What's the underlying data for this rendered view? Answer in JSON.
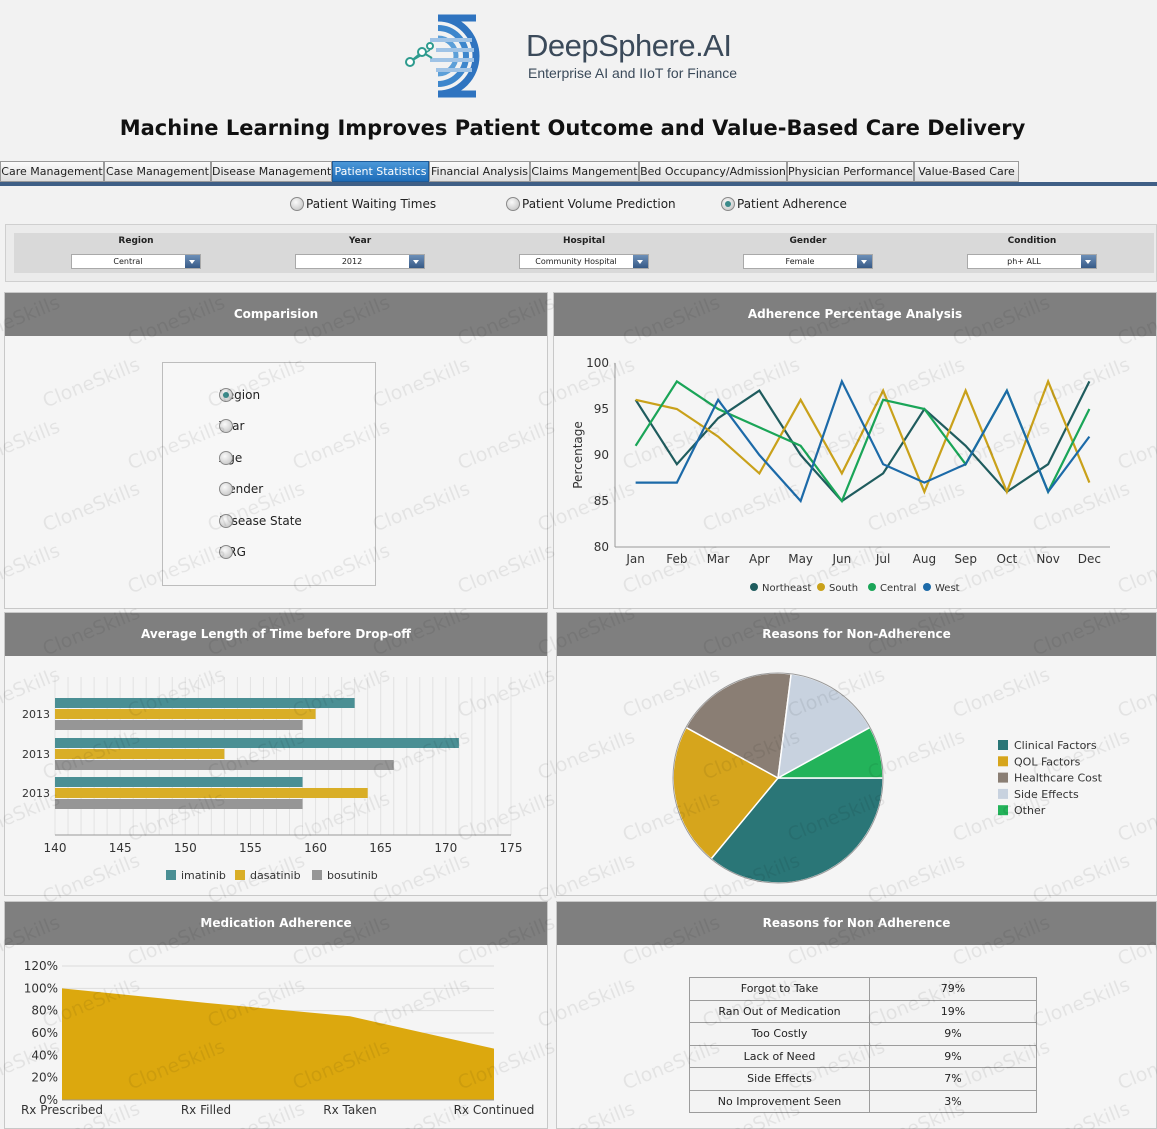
{
  "brand": {
    "name": "DeepSphere.AI",
    "tagline": "Enterprise AI and IIoT for Finance"
  },
  "page_title": "Machine Learning Improves Patient Outcome and Value-Based Care Delivery",
  "tabs": [
    {
      "label": "Care Management",
      "active": false
    },
    {
      "label": "Case Management",
      "active": false
    },
    {
      "label": "Disease Management",
      "active": false
    },
    {
      "label": "Patient Statistics",
      "active": true
    },
    {
      "label": "Financial Analysis",
      "active": false
    },
    {
      "label": "Claims Mangement",
      "active": false
    },
    {
      "label": "Bed Occupancy/Admission",
      "active": false
    },
    {
      "label": "Physician Performance",
      "active": false
    },
    {
      "label": "Value-Based Care",
      "active": false
    }
  ],
  "view_options": [
    {
      "label": "Patient Waiting Times",
      "selected": false
    },
    {
      "label": "Patient Volume Prediction",
      "selected": false
    },
    {
      "label": "Patient Adherence",
      "selected": true
    }
  ],
  "filters": [
    {
      "label": "Region",
      "value": "Central"
    },
    {
      "label": "Year",
      "value": "2012"
    },
    {
      "label": "Hospital",
      "value": "Community Hospital"
    },
    {
      "label": "Gender",
      "value": "Female"
    },
    {
      "label": "Condition",
      "value": "ph+ ALL"
    }
  ],
  "comparison": {
    "title": "Comparision",
    "options": [
      {
        "label": "Region",
        "selected": true
      },
      {
        "label": "Year",
        "selected": false
      },
      {
        "label": "Age",
        "selected": false
      },
      {
        "label": "Gender",
        "selected": false
      },
      {
        "label": "Disease State",
        "selected": false
      },
      {
        "label": "DRG",
        "selected": false
      }
    ]
  },
  "watermark": "CloneSkills",
  "colors": {
    "accent_tab": "#2a79c4",
    "panel_header": "#7f7f7f"
  },
  "chart_data": [
    {
      "type": "line",
      "title": "Adherence Percentage Analysis",
      "ylabel": "Percentage",
      "x": [
        "Jan",
        "Feb",
        "Mar",
        "Apr",
        "May",
        "Jun",
        "Jul",
        "Aug",
        "Sep",
        "Oct",
        "Nov",
        "Dec"
      ],
      "ylim": [
        80,
        100
      ],
      "yticks": [
        80,
        85,
        90,
        95,
        100
      ],
      "grid": false,
      "legend": "bottom",
      "series": [
        {
          "name": "Northeast",
          "color": "#1f5c5e",
          "values": [
            96,
            89,
            94,
            97,
            90,
            85,
            88,
            95,
            91,
            86,
            89,
            98
          ]
        },
        {
          "name": "South",
          "color": "#c9a11a",
          "values": [
            96,
            95,
            92,
            88,
            96,
            88,
            97,
            86,
            97,
            86,
            98,
            87
          ]
        },
        {
          "name": "Central",
          "color": "#1aa558",
          "values": [
            91,
            98,
            95,
            93,
            91,
            85,
            96,
            95,
            89,
            97,
            86,
            95
          ]
        },
        {
          "name": "West",
          "color": "#1c6aa8",
          "values": [
            87,
            87,
            96,
            90,
            85,
            98,
            89,
            87,
            89,
            97,
            86,
            92
          ]
        }
      ]
    },
    {
      "type": "bar",
      "orientation": "horizontal",
      "title": "Average Length of Time before Drop-off",
      "categories": [
        "2013",
        "2013",
        "2013"
      ],
      "xlim": [
        140,
        175
      ],
      "xticks": [
        140,
        145,
        150,
        155,
        160,
        165,
        170,
        175
      ],
      "grid": true,
      "legend": "bottom",
      "series": [
        {
          "name": "imatinib",
          "color": "#4a8f94",
          "values": [
            163,
            171,
            159
          ]
        },
        {
          "name": "dasatinib",
          "color": "#d9ae27",
          "values": [
            160,
            153,
            164
          ]
        },
        {
          "name": "bosutinib",
          "color": "#969696",
          "values": [
            159,
            166,
            159
          ]
        }
      ]
    },
    {
      "type": "pie",
      "title": "Reasons for Non-Adherence",
      "legend": "right",
      "slices": [
        {
          "label": "Clinical Factors",
          "value": 36,
          "color": "#2a7677"
        },
        {
          "label": "QOL Factors",
          "value": 22,
          "color": "#d6a51c"
        },
        {
          "label": "Healthcare Cost",
          "value": 19,
          "color": "#8a7e74"
        },
        {
          "label": "Side Effects",
          "value": 15,
          "color": "#c8d2df"
        },
        {
          "label": "Other",
          "value": 8,
          "color": "#23b35a"
        }
      ]
    },
    {
      "type": "area",
      "title": "Medication Adherence",
      "categories": [
        "Rx Prescribed",
        "Rx Filled",
        "Rx Taken",
        "Rx Continued"
      ],
      "yticks": [
        "0%",
        "20%",
        "40%",
        "60%",
        "80%",
        "100%",
        "120%"
      ],
      "ylim": [
        0,
        120
      ],
      "grid": true,
      "series": [
        {
          "name": "",
          "color": "#dca80e",
          "values": [
            100,
            87,
            75,
            46
          ]
        }
      ]
    },
    {
      "type": "table",
      "title": "Reasons for Non Adherence",
      "rows": [
        {
          "reason": "Forgot to Take",
          "value": "79%"
        },
        {
          "reason": "Ran Out of Medication",
          "value": "19%"
        },
        {
          "reason": "Too Costly",
          "value": "9%"
        },
        {
          "reason": "Lack of Need",
          "value": "9%"
        },
        {
          "reason": "Side Effects",
          "value": "7%"
        },
        {
          "reason": "No Improvement Seen",
          "value": "3%"
        }
      ]
    }
  ]
}
